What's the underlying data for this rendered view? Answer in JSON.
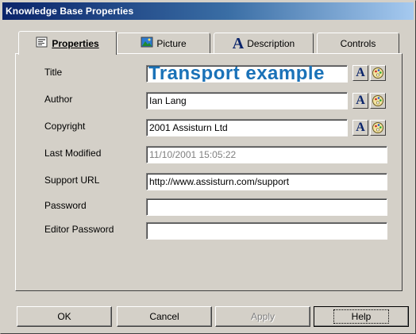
{
  "window": {
    "title": "Knowledge Base Properties"
  },
  "tabs": [
    {
      "label": "Properties",
      "icon": "properties-icon",
      "active": true
    },
    {
      "label": "Picture",
      "icon": "picture-icon",
      "active": false
    },
    {
      "label": "Description",
      "icon": "font-a-icon",
      "active": false
    },
    {
      "label": "Controls",
      "icon": "",
      "active": false
    }
  ],
  "fields": {
    "title": {
      "label": "Title",
      "value": "Transport example"
    },
    "author": {
      "label": "Author",
      "value": "Ian Lang"
    },
    "copyright": {
      "label": "Copyright",
      "value": "2001 Assisturn Ltd"
    },
    "last_modified": {
      "label": "Last Modified",
      "value": "11/10/2001 15:05:22"
    },
    "support_url": {
      "label": "Support URL",
      "value": "http://www.assisturn.com/support"
    },
    "password": {
      "label": "Password",
      "value": ""
    },
    "editor_password": {
      "label": "Editor Password",
      "value": ""
    }
  },
  "buttons": {
    "ok": "OK",
    "cancel": "Cancel",
    "apply": "Apply",
    "help": "Help"
  },
  "colors": {
    "title_text": "#1a72b8",
    "titlebar_start": "#0a246a",
    "titlebar_end": "#a6caf0",
    "face": "#d4d0c8"
  }
}
